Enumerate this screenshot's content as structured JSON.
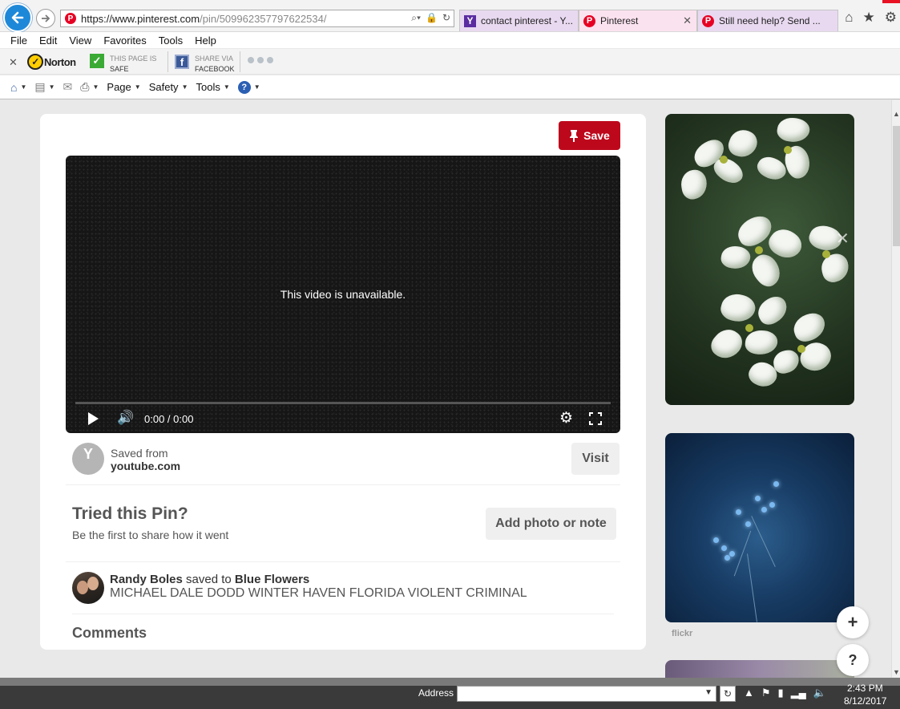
{
  "browser": {
    "url_host": "https://www.pinterest.com",
    "url_path": "/pin/509962357797622534/",
    "tabs": [
      {
        "label": "contact pinterest - Y..."
      },
      {
        "label": "Pinterest"
      },
      {
        "label": "Still need help? Send ..."
      }
    ],
    "menu": [
      "File",
      "Edit",
      "View",
      "Favorites",
      "Tools",
      "Help"
    ],
    "norton": {
      "logo": "Norton",
      "safe_line1": "THIS PAGE IS",
      "safe_line2": "SAFE",
      "share_line1": "SHARE VIA",
      "share_line2": "FACEBOOK"
    },
    "commands": {
      "page": "Page",
      "safety": "Safety",
      "tools": "Tools"
    }
  },
  "pin": {
    "save_label": "Save",
    "video_message": "This video is unavailable.",
    "video_time": "0:00 / 0:00",
    "source_initial": "Y",
    "saved_from": "Saved from",
    "source_domain": "youtube.com",
    "visit_label": "Visit",
    "tried_title": "Tried this Pin?",
    "tried_subtitle": "Be the first to share how it went",
    "add_note_label": "Add photo or note",
    "saver_name": "Randy Boles",
    "saved_to_text": "saved to",
    "board_name": "Blue Flowers",
    "description": "MICHAEL DALE DODD WINTER HAVEN FLORIDA VIOLENT CRIMINAL",
    "comments_title": "Comments"
  },
  "sidebar": {
    "second_source": "flickr",
    "fab_plus": "+",
    "fab_help": "?"
  },
  "taskbar": {
    "address_label": "Address",
    "time": "2:43 PM",
    "date": "8/12/2017"
  },
  "colors": {
    "save_red": "#bd081c",
    "ie_blue": "#1e88d8",
    "pinterest_red": "#e60023"
  }
}
